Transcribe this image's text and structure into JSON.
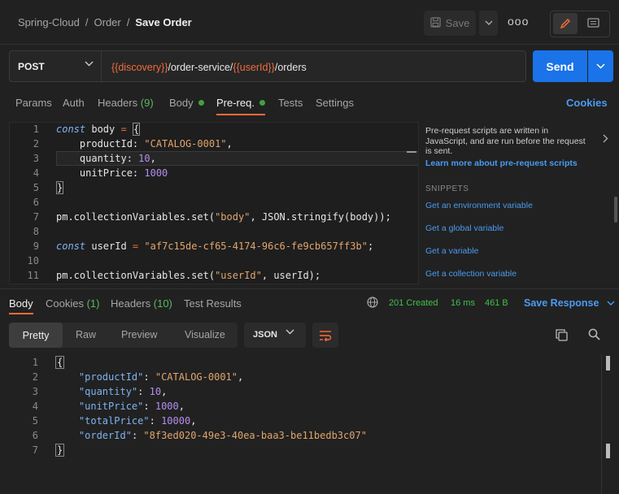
{
  "breadcrumb": {
    "collection": "Spring-Cloud",
    "folder": "Order",
    "request": "Save Order",
    "separator": "/"
  },
  "header": {
    "save_label": "Save",
    "more_label": "ooo"
  },
  "request": {
    "method": "POST",
    "url_parts": [
      {
        "text": "{{discovery}}",
        "var": true
      },
      {
        "text": "/order-service/",
        "var": false
      },
      {
        "text": "{{userId}}",
        "var": true
      },
      {
        "text": "/orders",
        "var": false
      }
    ],
    "send_label": "Send"
  },
  "request_tabs": {
    "params": "Params",
    "auth": "Auth",
    "headers": "Headers",
    "headers_count": "(9)",
    "body": "Body",
    "prereq": "Pre-req.",
    "tests": "Tests",
    "settings": "Settings",
    "cookies": "Cookies"
  },
  "script_lines": [
    {
      "n": "1",
      "code": "const body = {"
    },
    {
      "n": "2",
      "code": "    productId: \"CATALOG-0001\","
    },
    {
      "n": "3",
      "code": "    quantity: 10,"
    },
    {
      "n": "4",
      "code": "    unitPrice: 1000"
    },
    {
      "n": "5",
      "code": "}"
    },
    {
      "n": "6",
      "code": ""
    },
    {
      "n": "7",
      "code": "pm.collectionVariables.set(\"body\", JSON.stringify(body));"
    },
    {
      "n": "8",
      "code": ""
    },
    {
      "n": "9",
      "code": "const userId = \"af7c15de-cf65-4174-96c6-fe9cb657ff3b\";"
    },
    {
      "n": "10",
      "code": ""
    },
    {
      "n": "11",
      "code": "pm.collectionVariables.set(\"userId\", userId);"
    }
  ],
  "side_panel": {
    "info": "Pre-request scripts are written in JavaScript, and are run before the request is sent.",
    "learn_more": "Learn more about pre-request scripts",
    "snippets_title": "SNIPPETS",
    "snippets": [
      "Get an environment variable",
      "Get a global variable",
      "Get a variable",
      "Get a collection variable"
    ]
  },
  "response_tabs": {
    "body": "Body",
    "cookies": "Cookies",
    "cookies_count": "(1)",
    "headers": "Headers",
    "headers_count": "(10)",
    "test_results": "Test Results"
  },
  "response_meta": {
    "status": "201 Created",
    "time": "16 ms",
    "size": "461 B",
    "save_response": "Save Response"
  },
  "format_options": {
    "pretty": "Pretty",
    "raw": "Raw",
    "preview": "Preview",
    "visualize": "Visualize",
    "language": "JSON"
  },
  "response_lines": [
    {
      "n": "1",
      "code": "{"
    },
    {
      "n": "2",
      "code": "    \"productId\": \"CATALOG-0001\","
    },
    {
      "n": "3",
      "code": "    \"quantity\": 10,"
    },
    {
      "n": "4",
      "code": "    \"unitPrice\": 1000,"
    },
    {
      "n": "5",
      "code": "    \"totalPrice\": 10000,"
    },
    {
      "n": "6",
      "code": "    \"orderId\": \"8f3ed020-49e3-40ea-baa3-be11bedb3c07\""
    },
    {
      "n": "7",
      "code": "}"
    }
  ],
  "colors": {
    "accent": "#ff6c37",
    "link": "#4b9bf0",
    "send": "#1a73e8",
    "success": "#3fc04a",
    "variable": "#ee6c3e"
  }
}
